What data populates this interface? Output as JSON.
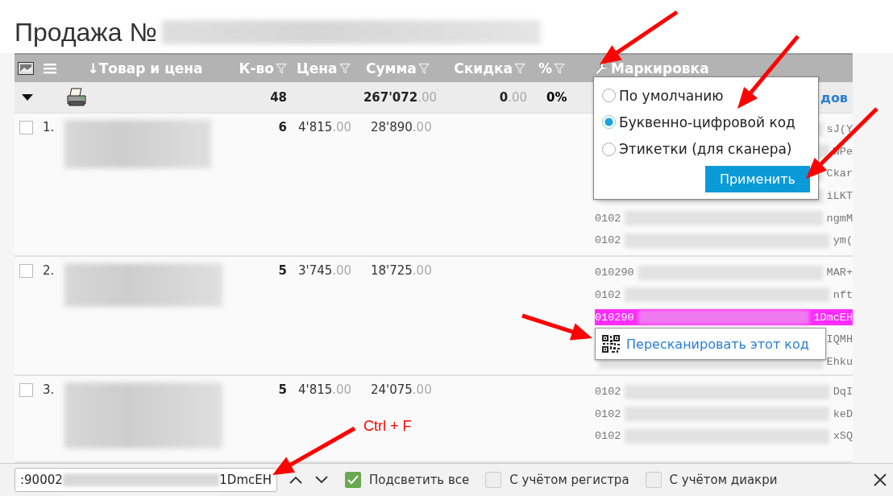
{
  "title": "Продажа №",
  "header": [
    {
      "label": "↓Товар и цена",
      "filter": false
    },
    {
      "label": "К-во",
      "filter": true
    },
    {
      "label": "Цена",
      "filter": true
    },
    {
      "label": "Сумма",
      "filter": true
    },
    {
      "label": "Скидка",
      "filter": true
    },
    {
      "label": "%",
      "filter": true
    },
    {
      "label": "Маркировка",
      "filter": false
    }
  ],
  "summary": {
    "qty": "48",
    "sum": "267'072",
    "sum_cents": ".00",
    "discount": "0",
    "discount_cents": ".00",
    "percent": "0%",
    "link": "дов"
  },
  "rows": [
    {
      "checked": false,
      "num": "1.",
      "qty": "6",
      "price": "4'815",
      "price_cents": ".00",
      "sum": "28'890",
      "sum_cents": ".00",
      "codes": [
        {
          "suffix": "sJ(Y",
          "highlighted": false
        },
        {
          "suffix": "WPe",
          "highlighted": false
        },
        {
          "suffix": "Ckar",
          "highlighted": false
        },
        {
          "suffix": "iLKT",
          "highlighted": false
        },
        {
          "prefix": "0102",
          "suffix": "ngmM",
          "highlighted": false
        },
        {
          "prefix": "0102",
          "suffix": "ym(",
          "highlighted": false
        }
      ]
    },
    {
      "checked": false,
      "num": "2.",
      "qty": "5",
      "price": "3'745",
      "price_cents": ".00",
      "sum": "18'725",
      "sum_cents": ".00",
      "codes": [
        {
          "prefix": "010290",
          "suffix": "MAR+",
          "highlighted": false
        },
        {
          "prefix": "0102",
          "suffix": "nft",
          "highlighted": false
        },
        {
          "prefix": "010290",
          "suffix": "1DmcEH",
          "highlighted": true
        },
        {
          "suffix": "IQMH",
          "highlighted": false
        },
        {
          "suffix": "Ehku",
          "highlighted": false
        }
      ]
    },
    {
      "checked": false,
      "num": "3.",
      "qty": "5",
      "price": "4'815",
      "price_cents": ".00",
      "sum": "24'075",
      "sum_cents": ".00",
      "codes": [
        {
          "prefix": "0102",
          "suffix": "DqI",
          "highlighted": false
        },
        {
          "prefix": "0102",
          "suffix": "keD",
          "highlighted": false
        },
        {
          "prefix": "0102",
          "suffix": "xSQ",
          "highlighted": false
        }
      ]
    }
  ],
  "marking_menu": {
    "options": [
      {
        "label": "По умолчанию",
        "selected": false
      },
      {
        "label": "Буквенно-цифровой код",
        "selected": true
      },
      {
        "label": "Этикетки (для сканера)",
        "selected": false
      }
    ],
    "apply": "Применить"
  },
  "context_menu": {
    "label": "Пересканировать этот код"
  },
  "find_bar": {
    "value_start": ":90002",
    "value_end": "1DmcEH",
    "options": [
      {
        "label": "Подсветить все",
        "checked": true
      },
      {
        "label": "С учётом регистра",
        "checked": false
      },
      {
        "label": "С учётом диакри",
        "checked": false
      }
    ]
  },
  "annotation": {
    "label": "Ctrl + F"
  }
}
